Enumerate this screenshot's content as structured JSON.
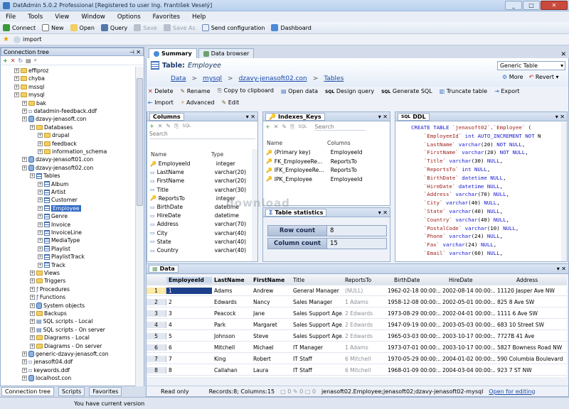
{
  "window": {
    "title": "DatAdmin 5.0.2 Professional [Registered to user Ing. František Veselý]",
    "min": "_",
    "max": "□",
    "close": "✕"
  },
  "menu": [
    "File",
    "Tools",
    "View",
    "Window",
    "Options",
    "Favorites",
    "Help"
  ],
  "toolbar": [
    {
      "label": "Connect",
      "icon": "connect-icon",
      "enabled": true
    },
    {
      "label": "New",
      "icon": "new-icon",
      "enabled": true
    },
    {
      "label": "Open",
      "icon": "open-folder-icon",
      "enabled": true
    },
    {
      "label": "Query",
      "icon": "sql-query-icon",
      "enabled": true
    },
    {
      "label": "Save",
      "icon": "save-icon",
      "enabled": false
    },
    {
      "label": "Save As",
      "icon": "save-as-icon",
      "enabled": false
    },
    {
      "label": "Send configuration",
      "icon": "mail-icon",
      "enabled": true
    },
    {
      "label": "Dashboard",
      "icon": "dashboard-icon",
      "enabled": true
    }
  ],
  "favorites_bar": {
    "item": "import"
  },
  "connection_tree": {
    "title": "Connection tree",
    "items": [
      {
        "label": "effiproz",
        "level": 1,
        "icon": "folder"
      },
      {
        "label": "chyba",
        "level": 1,
        "icon": "folder"
      },
      {
        "label": "mssql",
        "level": 1,
        "icon": "folder"
      },
      {
        "label": "mysql",
        "level": 1,
        "icon": "folder"
      },
      {
        "label": "bak",
        "level": 2,
        "icon": "folder"
      },
      {
        "label": "datadmin-feedback.ddf",
        "level": 2,
        "icon": "file"
      },
      {
        "label": "dzavy-jenasoft.con",
        "level": 2,
        "icon": "db"
      },
      {
        "label": "Databases",
        "level": 3,
        "icon": "folder"
      },
      {
        "label": "drupal",
        "level": 4,
        "icon": "folder"
      },
      {
        "label": "feedback",
        "level": 4,
        "icon": "folder"
      },
      {
        "label": "information_schema",
        "level": 4,
        "icon": "folder"
      },
      {
        "label": "dzavy-jenasoft01.con",
        "level": 2,
        "icon": "db"
      },
      {
        "label": "dzavy-jenasoft02.con",
        "level": 2,
        "icon": "db"
      },
      {
        "label": "Tables",
        "level": 3,
        "icon": "table"
      },
      {
        "label": "Album",
        "level": 4,
        "icon": "table"
      },
      {
        "label": "Artist",
        "level": 4,
        "icon": "table"
      },
      {
        "label": "Customer",
        "level": 4,
        "icon": "table"
      },
      {
        "label": "Employee",
        "level": 4,
        "icon": "table",
        "selected": true
      },
      {
        "label": "Genre",
        "level": 4,
        "icon": "table"
      },
      {
        "label": "Invoice",
        "level": 4,
        "icon": "table"
      },
      {
        "label": "InvoiceLine",
        "level": 4,
        "icon": "table"
      },
      {
        "label": "MediaType",
        "level": 4,
        "icon": "table"
      },
      {
        "label": "Playlist",
        "level": 4,
        "icon": "table"
      },
      {
        "label": "PlaylistTrack",
        "level": 4,
        "icon": "table"
      },
      {
        "label": "Track",
        "level": 4,
        "icon": "table"
      },
      {
        "label": "Views",
        "level": 3,
        "icon": "folder"
      },
      {
        "label": "Triggers",
        "level": 3,
        "icon": "folder"
      },
      {
        "label": "Procedures",
        "level": 3,
        "icon": "proc"
      },
      {
        "label": "Functions",
        "level": 3,
        "icon": "func"
      },
      {
        "label": "System objects",
        "level": 3,
        "icon": "db"
      },
      {
        "label": "Backups",
        "level": 3,
        "icon": "folder"
      },
      {
        "label": "SQL scripts - Local",
        "level": 3,
        "icon": "sql"
      },
      {
        "label": "SQL scripts - On server",
        "level": 3,
        "icon": "sql"
      },
      {
        "label": "Diagrams - Local",
        "level": 3,
        "icon": "folder"
      },
      {
        "label": "Diagrams - On server",
        "level": 3,
        "icon": "folder"
      },
      {
        "label": "generic-dzavy-jenasoft.con",
        "level": 2,
        "icon": "db"
      },
      {
        "label": "jenasoft04.ddf",
        "level": 2,
        "icon": "file"
      },
      {
        "label": "keywords.ddf",
        "level": 2,
        "icon": "file"
      },
      {
        "label": "localhost.con",
        "level": 2,
        "icon": "db"
      }
    ]
  },
  "bottom_tabs": [
    "Connection tree",
    "Scripts",
    "Favorites"
  ],
  "main_tabs": [
    "Summary",
    "Data browser"
  ],
  "table_header": {
    "prefix": "Table:",
    "name": "Employee",
    "dropdown": "Generic Table",
    "more": "More",
    "revert": "Revert"
  },
  "breadcrumb": [
    "Data",
    "mysql",
    "dzavy-jenasoft02.con",
    "Tables"
  ],
  "actions": [
    "Delete",
    "Rename",
    "Copy to clipboard",
    "Open data",
    "Design query",
    "Generate SQL",
    "Truncate table",
    "Export"
  ],
  "actions2": [
    "Import",
    "Advanced",
    "Edit"
  ],
  "columns_panel": {
    "title": "Columns",
    "search": "Search",
    "headers": [
      "Name",
      "Type"
    ],
    "rows": [
      [
        "EmployeeId",
        "integer"
      ],
      [
        "LastName",
        "varchar(20)"
      ],
      [
        "FirstName",
        "varchar(20)"
      ],
      [
        "Title",
        "varchar(30)"
      ],
      [
        "ReportsTo",
        "integer"
      ],
      [
        "BirthDate",
        "datetime"
      ],
      [
        "HireDate",
        "datetime"
      ],
      [
        "Address",
        "varchar(70)"
      ],
      [
        "City",
        "varchar(40)"
      ],
      [
        "State",
        "varchar(40)"
      ],
      [
        "Country",
        "varchar(40)"
      ]
    ]
  },
  "indexes_panel": {
    "title": "Indexes_Keys",
    "search": "Search",
    "headers": [
      "Name",
      "Columns"
    ],
    "rows": [
      [
        "(Primary key)",
        "EmployeeId"
      ],
      [
        "FK_EmployeeRe...",
        "ReportsTo"
      ],
      [
        "IFK_EmployeeRe...",
        "ReportsTo"
      ],
      [
        "IPK_Employee",
        "EmployeeId"
      ]
    ]
  },
  "stats_panel": {
    "title": "Table statistics",
    "rows": [
      [
        "Row count",
        "8"
      ],
      [
        "Column count",
        "15"
      ]
    ]
  },
  "ddl_panel": {
    "title": "DDL",
    "lines": [
      "CREATE TABLE `jenasoft02`.`Employee` (",
      "    `EmployeeId` int AUTO_INCREMENT NOT N",
      "    `LastName` varchar(20) NOT NULL,",
      "    `FirstName` varchar(20) NOT NULL,",
      "    `Title` varchar(30) NULL,",
      "    `ReportsTo` int NULL,",
      "    `BirthDate` datetime NULL,",
      "    `HireDate` datetime NULL,",
      "    `Address` varchar(70) NULL,",
      "    `City` varchar(40) NULL,",
      "    `State` varchar(40) NULL,",
      "    `Country` varchar(40) NULL,",
      "    `PostalCode` varchar(10) NULL,",
      "    `Phone` varchar(24) NULL,",
      "    `Fax` varchar(24) NULL,",
      "    `Email` varchar(60) NULL,"
    ]
  },
  "watermark": "download",
  "data_panel": {
    "title": "Data",
    "headers": [
      "EmployeeId",
      "LastName",
      "FirstName",
      "Title",
      "ReportsTo",
      "BirthDate",
      "HireDate",
      "Address"
    ],
    "rows": [
      [
        "1",
        "1",
        "Adams",
        "Andrew",
        "General Manager",
        "(NULL)",
        "1962-02-18  00:00:...",
        "2002-08-14  00:00:...",
        "11120 Jasper Ave NW"
      ],
      [
        "2",
        "2",
        "Edwards",
        "Nancy",
        "Sales Manager",
        "1 Adams",
        "1958-12-08  00:00:...",
        "2002-05-01  00:00:...",
        "825 8 Ave SW"
      ],
      [
        "3",
        "3",
        "Peacock",
        "Jane",
        "Sales Support Age...",
        "2 Edwards",
        "1973-08-29  00:00:...",
        "2002-04-01  00:00:...",
        "1111 6 Ave SW"
      ],
      [
        "4",
        "4",
        "Park",
        "Margaret",
        "Sales Support Age...",
        "2 Edwards",
        "1947-09-19  00:00:...",
        "2003-05-03  00:00:...",
        "683 10 Street SW"
      ],
      [
        "5",
        "5",
        "Johnson",
        "Steve",
        "Sales Support Age...",
        "2 Edwards",
        "1965-03-03  00:00:...",
        "2003-10-17  00:00:...",
        "7727B 41 Ave"
      ],
      [
        "6",
        "6",
        "Mitchell",
        "Michael",
        "IT Manager",
        "1 Adams",
        "1973-07-01  00:00:...",
        "2003-10-17  00:00:...",
        "5827 Bowness Road NW"
      ],
      [
        "7",
        "7",
        "King",
        "Robert",
        "IT Staff",
        "6 Mitchell",
        "1970-05-29  00:00:...",
        "2004-01-02  00:00:...",
        "590 Columbia Boulevard"
      ],
      [
        "8",
        "8",
        "Callahan",
        "Laura",
        "IT Staff",
        "6 Mitchell",
        "1968-01-09  00:00:...",
        "2004-03-04  00:00:...",
        "923 7 ST NW"
      ]
    ]
  },
  "data_status": {
    "mode": "Read only",
    "records": "Records:8; Columns:15",
    "counts": [
      "0",
      "0",
      "0"
    ],
    "path": "jenasoft02.Employee;jenasoft02;dzavy-jenasoft02-mysql",
    "link": "Open for editing"
  },
  "status": {
    "message": "You have current version"
  }
}
